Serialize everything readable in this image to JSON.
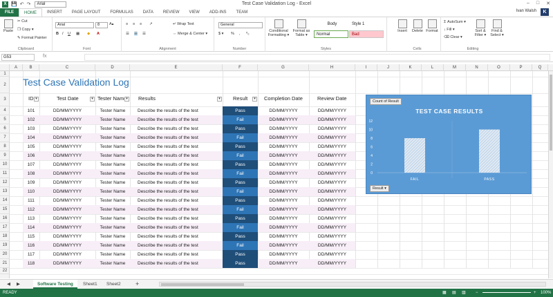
{
  "window": {
    "title": "Test Case Validation Log - Excel",
    "quick_font": "Arial",
    "user": "Ivan Walsh",
    "user_initial": "K",
    "min": "–",
    "max": "□",
    "close": "✕"
  },
  "ribbon_tabs": [
    "FILE",
    "HOME",
    "INSERT",
    "PAGE LAYOUT",
    "FORMULAS",
    "DATA",
    "REVIEW",
    "VIEW",
    "ADD-INS",
    "TEAM"
  ],
  "ribbon": {
    "clipboard": {
      "paste": "Paste",
      "cut": "Cut",
      "copy": "Copy ▾",
      "painter": "Format Painter",
      "label": "Clipboard"
    },
    "font": {
      "name": "Arial",
      "size": "8",
      "label": "Font"
    },
    "alignment": {
      "wrap": "Wrap Text",
      "merge": "Merge & Center ▾",
      "label": "Alignment"
    },
    "number": {
      "format": "General",
      "currency": "$ ▾",
      "percent": "%",
      "comma": ",",
      "label": "Number"
    },
    "styles": {
      "cond": "Conditional Formatting ▾",
      "table": "Format as Table ▾",
      "body": "Body",
      "style1": "Style 1",
      "normal": "Normal",
      "bad": "Bad",
      "label": "Styles"
    },
    "cells": {
      "insert": "Insert",
      "delete": "Delete",
      "format": "Format",
      "label": "Cells"
    },
    "editing": {
      "autosum": "AutoSum ▾",
      "fill": "Fill ▾",
      "clear": "Clear ▾",
      "sort": "Sort & Filter ▾",
      "find": "Find & Select ▾",
      "label": "Editing"
    }
  },
  "formula_bar": {
    "name_box": "G53",
    "fx": "fx",
    "value": ""
  },
  "columns": [
    "A",
    "B",
    "C",
    "D",
    "E",
    "F",
    "G",
    "H",
    "I",
    "J",
    "K",
    "L",
    "M",
    "N",
    "O",
    "P",
    "Q"
  ],
  "rows": [
    "1",
    "2",
    "3",
    "4",
    "5",
    "6",
    "7",
    "8",
    "9",
    "10",
    "11",
    "12",
    "13",
    "14",
    "15",
    "16",
    "17",
    "18",
    "19",
    "20",
    "21",
    "22"
  ],
  "sheet_title": "Test Case Validation Log",
  "table_headers": [
    "ID",
    "Test Date",
    "Tester Name",
    "Results",
    "Result",
    "Completion Date",
    "Review Date"
  ],
  "table_rows": [
    {
      "id": "101",
      "date": "DD/MM/YYYY",
      "tester": "Tester Name",
      "results": "Describe the results of the test",
      "result": "Pass",
      "completion": "DD/MM/YYYY",
      "review": "DD/MM/YYYY"
    },
    {
      "id": "102",
      "date": "DD/MM/YYYY",
      "tester": "Tester Name",
      "results": "Describe the results of the test",
      "result": "Fail",
      "completion": "DD/MM/YYYY",
      "review": "DD/MM/YYYY"
    },
    {
      "id": "103",
      "date": "DD/MM/YYYY",
      "tester": "Tester Name",
      "results": "Describe the results of the test",
      "result": "Pass",
      "completion": "DD/MM/YYYY",
      "review": "DD/MM/YYYY"
    },
    {
      "id": "104",
      "date": "DD/MM/YYYY",
      "tester": "Tester Name",
      "results": "Describe the results of the test",
      "result": "Fail",
      "completion": "DD/MM/YYYY",
      "review": "DD/MM/YYYY"
    },
    {
      "id": "105",
      "date": "DD/MM/YYYY",
      "tester": "Tester Name",
      "results": "Describe the results of the test",
      "result": "Pass",
      "completion": "DD/MM/YYYY",
      "review": "DD/MM/YYYY"
    },
    {
      "id": "106",
      "date": "DD/MM/YYYY",
      "tester": "Tester Name",
      "results": "Describe the results of the test",
      "result": "Fail",
      "completion": "DD/MM/YYYY",
      "review": "DD/MM/YYYY"
    },
    {
      "id": "107",
      "date": "DD/MM/YYYY",
      "tester": "Tester Name",
      "results": "Describe the results of the test",
      "result": "Pass",
      "completion": "DD/MM/YYYY",
      "review": "DD/MM/YYYY"
    },
    {
      "id": "108",
      "date": "DD/MM/YYYY",
      "tester": "Tester Name",
      "results": "Describe the results of the test",
      "result": "Fail",
      "completion": "DD/MM/YYYY",
      "review": "DD/MM/YYYY"
    },
    {
      "id": "109",
      "date": "DD/MM/YYYY",
      "tester": "Tester Name",
      "results": "Describe the results of the test",
      "result": "Pass",
      "completion": "DD/MM/YYYY",
      "review": "DD/MM/YYYY"
    },
    {
      "id": "110",
      "date": "DD/MM/YYYY",
      "tester": "Tester Name",
      "results": "Describe the results of the test",
      "result": "Fail",
      "completion": "DD/MM/YYYY",
      "review": "DD/MM/YYYY"
    },
    {
      "id": "111",
      "date": "DD/MM/YYYY",
      "tester": "Tester Name",
      "results": "Describe the results of the test",
      "result": "Pass",
      "completion": "DD/MM/YYYY",
      "review": "DD/MM/YYYY"
    },
    {
      "id": "112",
      "date": "DD/MM/YYYY",
      "tester": "Tester Name",
      "results": "Describe the results of the test",
      "result": "Fail",
      "completion": "DD/MM/YYYY",
      "review": "DD/MM/YYYY"
    },
    {
      "id": "113",
      "date": "DD/MM/YYYY",
      "tester": "Tester Name",
      "results": "Describe the results of the test",
      "result": "Pass",
      "completion": "DD/MM/YYYY",
      "review": "DD/MM/YYYY"
    },
    {
      "id": "114",
      "date": "DD/MM/YYYY",
      "tester": "Tester Name",
      "results": "Describe the results of the test",
      "result": "Fail",
      "completion": "DD/MM/YYYY",
      "review": "DD/MM/YYYY"
    },
    {
      "id": "115",
      "date": "DD/MM/YYYY",
      "tester": "Tester Name",
      "results": "Describe the results of the test",
      "result": "Pass",
      "completion": "DD/MM/YYYY",
      "review": "DD/MM/YYYY"
    },
    {
      "id": "116",
      "date": "DD/MM/YYYY",
      "tester": "Tester Name",
      "results": "Describe the results of the test",
      "result": "Fail",
      "completion": "DD/MM/YYYY",
      "review": "DD/MM/YYYY"
    },
    {
      "id": "117",
      "date": "DD/MM/YYYY",
      "tester": "Tester Name",
      "results": "Describe the results of the test",
      "result": "Pass",
      "completion": "DD/MM/YYYY",
      "review": "DD/MM/YYYY"
    },
    {
      "id": "118",
      "date": "DD/MM/YYYY",
      "tester": "Tester Name",
      "results": "Describe the results of the test",
      "result": "Pass",
      "completion": "DD/MM/YYYY",
      "review": "DD/MM/YYYY"
    }
  ],
  "chart_tag": "Count of Result",
  "chart_filter": "Result ▾",
  "chart_data": {
    "type": "bar",
    "title": "TEST CASE RESULTS",
    "categories": [
      "FAIL",
      "PASS"
    ],
    "values": [
      8,
      10
    ],
    "ylim": [
      0,
      12
    ],
    "yticks": [
      "0",
      "2",
      "4",
      "6",
      "8",
      "10",
      "12"
    ],
    "grid": false,
    "bar_color": "#dfe9f3",
    "background": "#5b9bd5"
  },
  "sheet_tabs": [
    "Software Testing",
    "Sheet1",
    "Sheet2"
  ],
  "add_sheet": "+",
  "status": {
    "ready": "READY",
    "zoom": "100%"
  },
  "colors": {
    "pass": "#1f4e79",
    "fail": "#2e75b6",
    "accent": "#217346",
    "title": "#2e75b6"
  }
}
